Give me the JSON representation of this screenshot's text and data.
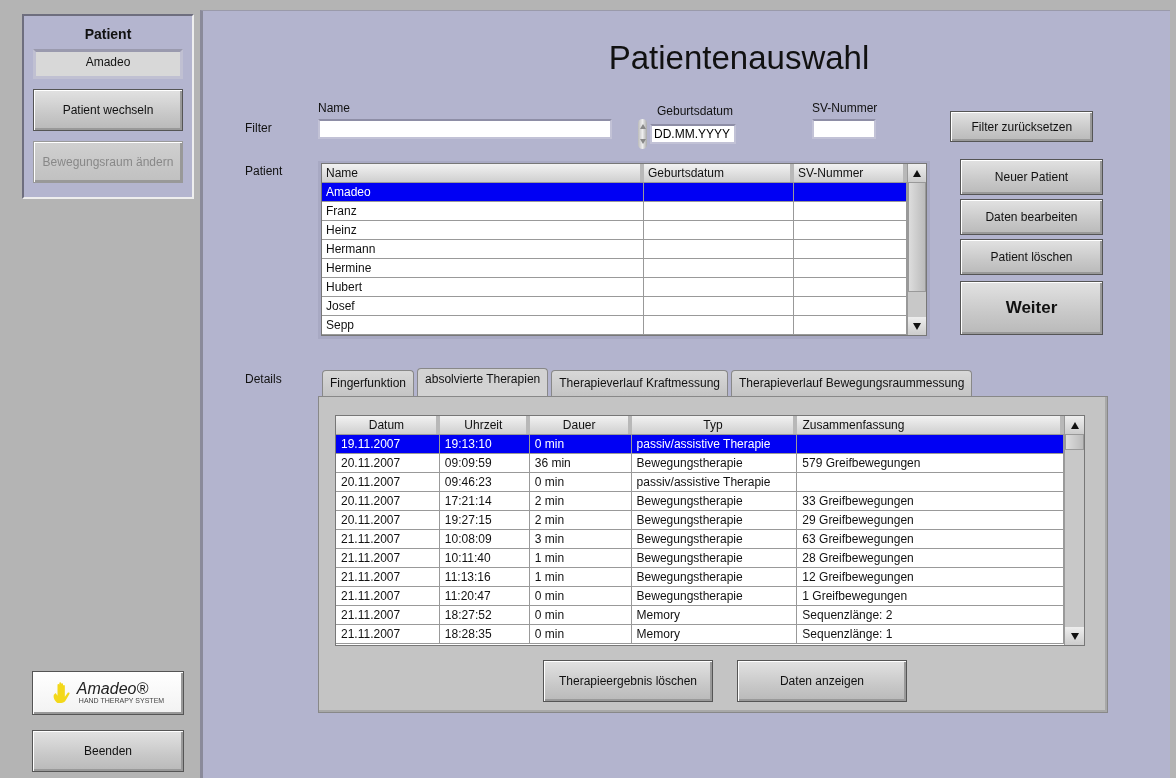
{
  "sidebar": {
    "title": "Patient",
    "current_patient": "Amadeo",
    "buttons": [
      {
        "label": "Patient wechseln",
        "disabled": false
      },
      {
        "label": "Bewegungsraum ändern",
        "disabled": true
      }
    ],
    "logo": {
      "name": "Amadeo®",
      "tagline": "HAND THERAPY SYSTEM"
    },
    "exit_button": "Beenden"
  },
  "title": "Patientenauswahl",
  "filter": {
    "label": "Filter",
    "name_label": "Name",
    "date_label": "Geburtsdatum",
    "date_value": "DD.MM.YYYY",
    "sv_label": "SV-Nummer",
    "reset_button": "Filter zurücksetzen"
  },
  "patients": {
    "label": "Patient",
    "columns": [
      "Name",
      "Geburtsdatum",
      "SV-Nummer"
    ],
    "rows": [
      {
        "cells": [
          "Amadeo",
          "",
          ""
        ],
        "selected": true
      },
      {
        "cells": [
          "Franz",
          "",
          ""
        ],
        "selected": false
      },
      {
        "cells": [
          "Heinz",
          "",
          ""
        ],
        "selected": false
      },
      {
        "cells": [
          "Hermann",
          "",
          ""
        ],
        "selected": false
      },
      {
        "cells": [
          "Hermine",
          "",
          ""
        ],
        "selected": false
      },
      {
        "cells": [
          "Hubert",
          "",
          ""
        ],
        "selected": false
      },
      {
        "cells": [
          "Josef",
          "",
          ""
        ],
        "selected": false
      },
      {
        "cells": [
          "Sepp",
          "",
          ""
        ],
        "selected": false
      }
    ]
  },
  "patient_buttons": [
    {
      "label": "Neuer Patient",
      "kind": "normal"
    },
    {
      "label": "Daten bearbeiten",
      "kind": "normal"
    },
    {
      "label": "Patient löschen",
      "kind": "normal"
    },
    {
      "label": "Weiter",
      "kind": "primary"
    }
  ],
  "details": {
    "label": "Details",
    "tabs": [
      {
        "label": "Fingerfunktion",
        "selected": false
      },
      {
        "label": "absolvierte Therapien",
        "selected": true
      },
      {
        "label": "Therapieverlauf Kraftmessung",
        "selected": false
      },
      {
        "label": "Therapieverlauf Bewegungsraummessung",
        "selected": false
      }
    ],
    "columns": [
      "Datum",
      "Uhrzeit",
      "Dauer",
      "Typ",
      "Zusammenfassung"
    ],
    "rows": [
      {
        "cells": [
          "19.11.2007",
          "19:13:10",
          "0 min",
          "passiv/assistive Therapie",
          ""
        ],
        "selected": true
      },
      {
        "cells": [
          "20.11.2007",
          "09:09:59",
          "36 min",
          "Bewegungstherapie",
          "579 Greifbewegungen"
        ],
        "selected": false
      },
      {
        "cells": [
          "20.11.2007",
          "09:46:23",
          "0 min",
          "passiv/assistive Therapie",
          ""
        ],
        "selected": false
      },
      {
        "cells": [
          "20.11.2007",
          "17:21:14",
          "2 min",
          "Bewegungstherapie",
          "33 Greifbewegungen"
        ],
        "selected": false
      },
      {
        "cells": [
          "20.11.2007",
          "19:27:15",
          "2 min",
          "Bewegungstherapie",
          "29 Greifbewegungen"
        ],
        "selected": false
      },
      {
        "cells": [
          "21.11.2007",
          "10:08:09",
          "3 min",
          "Bewegungstherapie",
          "63 Greifbewegungen"
        ],
        "selected": false
      },
      {
        "cells": [
          "21.11.2007",
          "10:11:40",
          "1 min",
          "Bewegungstherapie",
          "28 Greifbewegungen"
        ],
        "selected": false
      },
      {
        "cells": [
          "21.11.2007",
          "11:13:16",
          "1 min",
          "Bewegungstherapie",
          "12 Greifbewegungen"
        ],
        "selected": false
      },
      {
        "cells": [
          "21.11.2007",
          "11:20:47",
          "0 min",
          "Bewegungstherapie",
          "1 Greifbewegungen"
        ],
        "selected": false
      },
      {
        "cells": [
          "21.11.2007",
          "18:27:52",
          "0 min",
          "Memory",
          "Sequenzlänge: 2"
        ],
        "selected": false
      },
      {
        "cells": [
          "21.11.2007",
          "18:28:35",
          "0 min",
          "Memory",
          "Sequenzlänge: 1"
        ],
        "selected": false
      }
    ],
    "buttons": [
      "Therapieergebnis löschen",
      "Daten anzeigen"
    ]
  }
}
